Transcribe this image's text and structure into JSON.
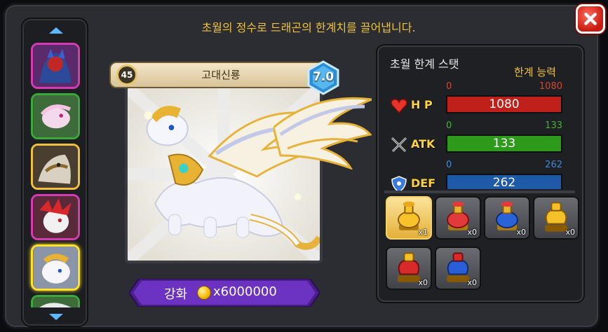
{
  "header": {
    "title": "초월의 정수로 드래곤의 한계치를 끌어냅니다."
  },
  "dragon": {
    "level": "45",
    "name": "고대신룡",
    "grade": "7.0"
  },
  "upgrade": {
    "label": "강화",
    "cost": "x6000000"
  },
  "stats_panel": {
    "title": "초월 한계 스탯",
    "ability_label": "한계 능력",
    "stats": [
      {
        "name": "H P",
        "icon": "heart-icon",
        "min": "0",
        "max": "1080",
        "value": "1080",
        "fill": 1.0,
        "color": "#c0201a",
        "range_color": "#e0402a"
      },
      {
        "name": "ATK",
        "icon": "crossed-swords-icon",
        "min": "0",
        "max": "133",
        "value": "133",
        "fill": 1.0,
        "color": "#2e9a1c",
        "range_color": "#3cb82a"
      },
      {
        "name": "DEF",
        "icon": "shield-icon",
        "min": "0",
        "max": "262",
        "value": "262",
        "fill": 1.0,
        "color": "#1e5aa8",
        "range_color": "#3a8ae0"
      }
    ]
  },
  "items": [
    {
      "icon": "gold-essence-icon",
      "count": "x1",
      "selected": true
    },
    {
      "icon": "red-essence-icon",
      "count": "x0",
      "selected": false
    },
    {
      "icon": "blue-essence-icon",
      "count": "x0",
      "selected": false
    },
    {
      "icon": "gold-jar-icon",
      "count": "x0",
      "selected": false
    },
    {
      "icon": "red-jar-icon",
      "count": "x0",
      "selected": false
    },
    {
      "icon": "blue-jar-icon",
      "count": "x0",
      "selected": false
    }
  ],
  "list": {
    "thumbs": [
      {
        "icon": "dark-dragon-icon",
        "border": "#d63bb4"
      },
      {
        "icon": "pink-dragon-icon",
        "border": "#3aa83a"
      },
      {
        "icon": "armored-dragon-icon",
        "border": "#f0c23a"
      },
      {
        "icon": "red-dragon-icon",
        "border": "#d63bb4"
      },
      {
        "icon": "white-dragon-icon",
        "border": "#ffe12a",
        "selected": true
      },
      {
        "icon": "green-dragon-icon",
        "border": "#3aa83a"
      }
    ]
  }
}
